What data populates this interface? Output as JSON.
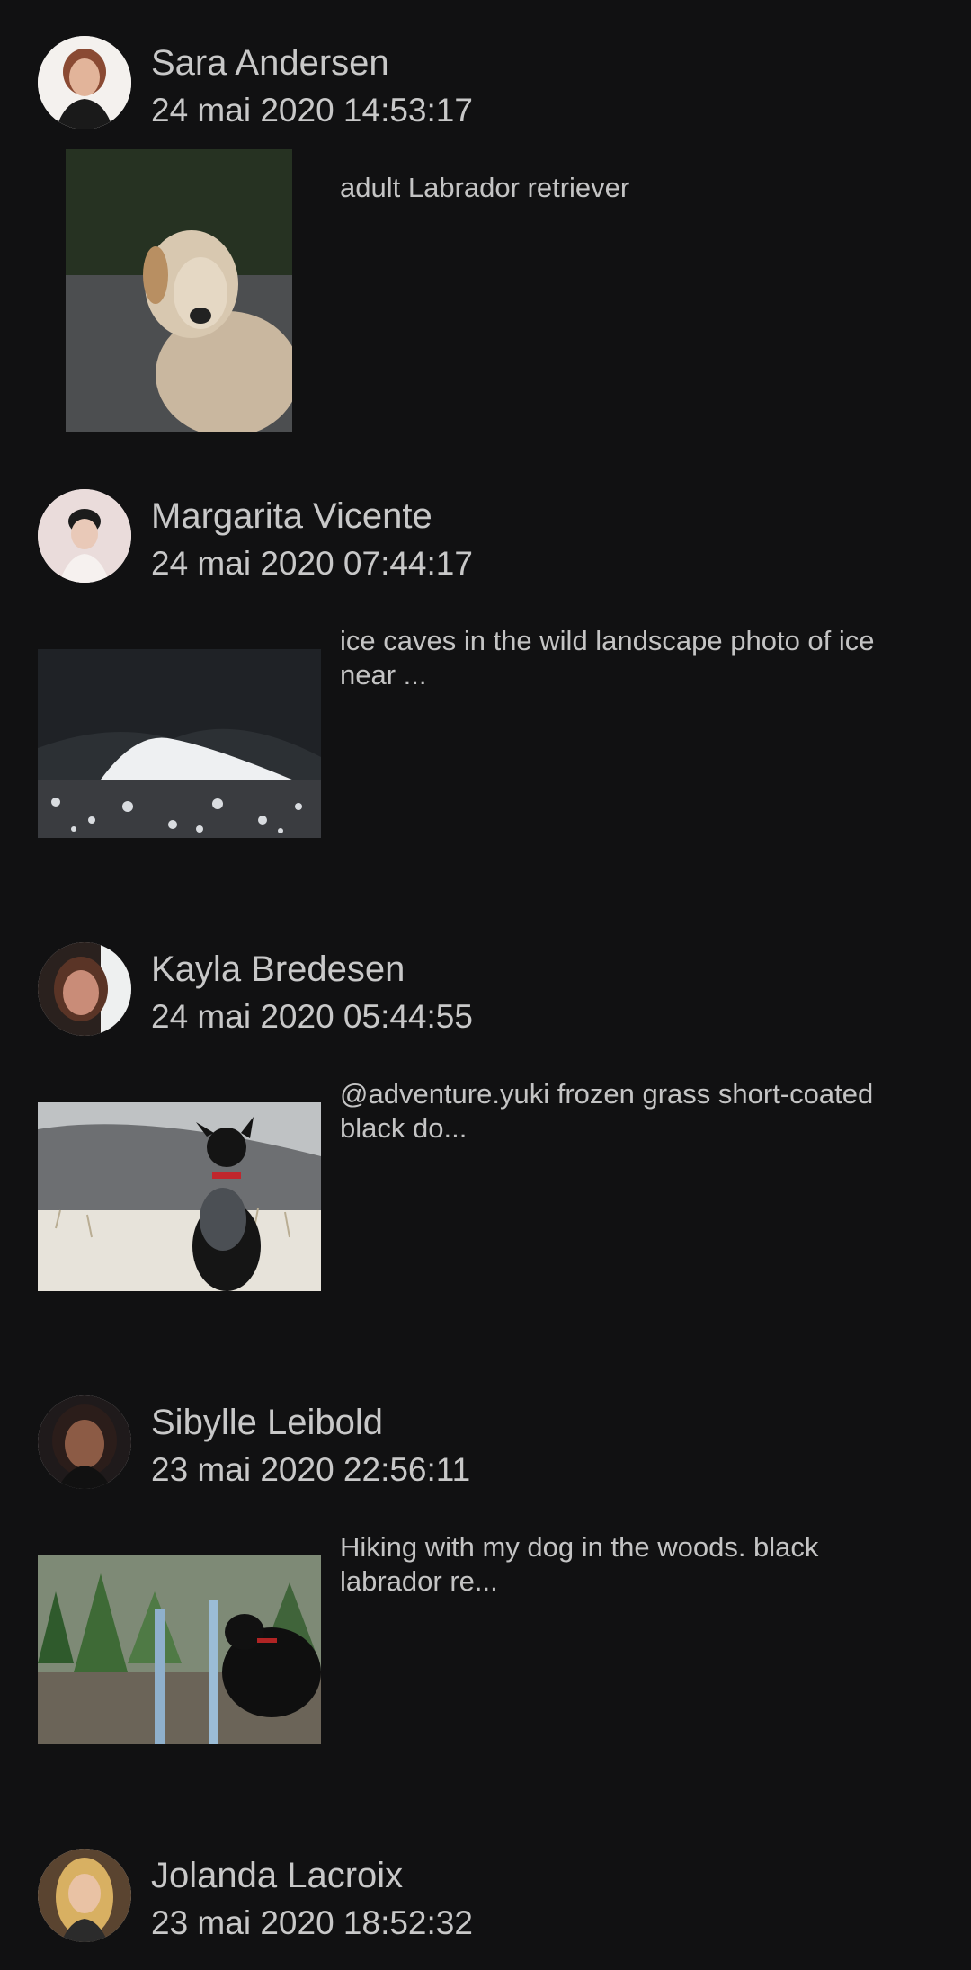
{
  "feed": {
    "posts": [
      {
        "author": "Sara Andersen",
        "timestamp": "24 mai 2020 14:53:17",
        "caption": "adult Labrador retriever"
      },
      {
        "author": "Margarita Vicente",
        "timestamp": "24 mai 2020 07:44:17",
        "caption": "ice caves in the wild landscape photo of ice near ..."
      },
      {
        "author": "Kayla Bredesen",
        "timestamp": "24 mai 2020 05:44:55",
        "caption": "@adventure.yuki frozen grass short-coated black do..."
      },
      {
        "author": "Sibylle Leibold",
        "timestamp": "23 mai 2020 22:56:11",
        "caption": "Hiking with my dog in the woods. black labrador re..."
      },
      {
        "author": "Jolanda Lacroix",
        "timestamp": "23 mai 2020 18:52:32",
        "caption": ""
      }
    ]
  },
  "colors": {
    "background": "#111112",
    "text": "#c8c8c8"
  }
}
